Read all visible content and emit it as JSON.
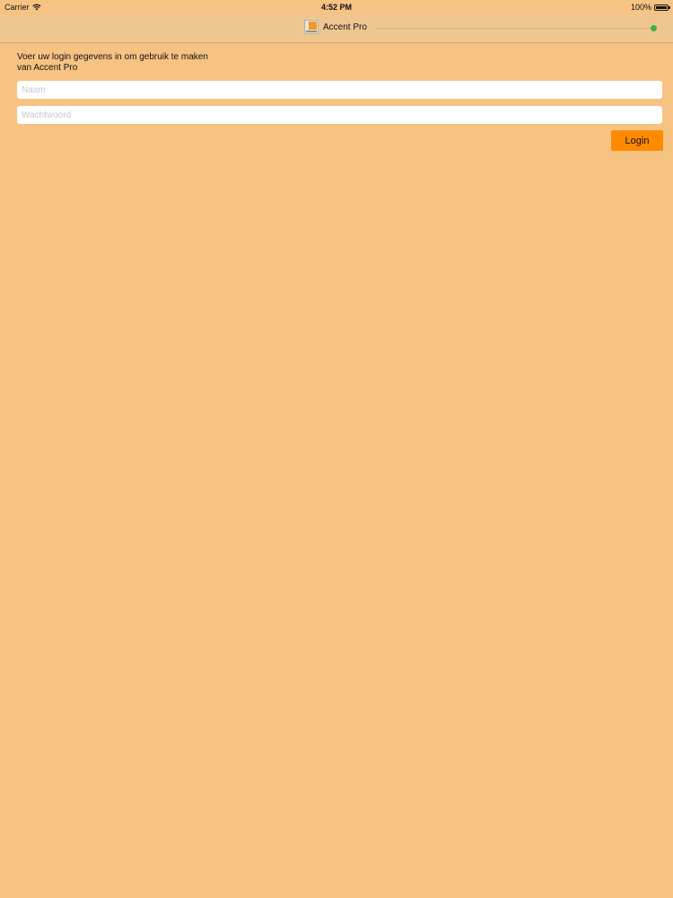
{
  "status_bar": {
    "carrier": "Carrier",
    "time": "4:52 PM",
    "battery": "100%",
    "battery_level": 1.0,
    "icons": [
      "wifi-icon",
      "battery-icon"
    ]
  },
  "nav": {
    "title": "Accent Pro",
    "logo_icon": "accent-pro-logo",
    "connection_status_color": "#3cb43c"
  },
  "login": {
    "intro_text": "Voer uw login gegevens in om gebruik te maken van Accent Pro",
    "name_placeholder": "Naam",
    "password_placeholder": "Wachtwoord",
    "login_label": "Login"
  },
  "colors": {
    "background": "#f6c383",
    "accent": "#ff8a00"
  }
}
